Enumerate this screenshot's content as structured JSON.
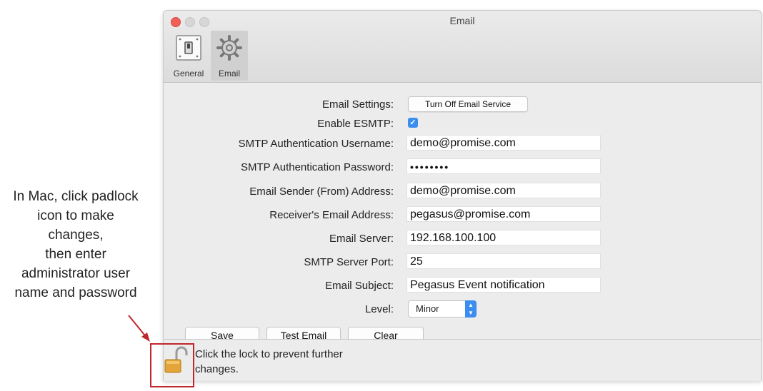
{
  "annotation": {
    "lines": [
      "In Mac, click padlock",
      "icon to make",
      "changes,",
      "then enter",
      "administrator user",
      "name and password"
    ],
    "color": "#c0272d"
  },
  "window": {
    "title": "Email",
    "toolbar": [
      {
        "label": "General",
        "icon": "general-switch-icon"
      },
      {
        "label": "Email",
        "icon": "gear-icon"
      }
    ]
  },
  "form": {
    "email_settings": {
      "label": "Email Settings:",
      "button": "Turn Off Email Service"
    },
    "enable_esmtp": {
      "label": "Enable ESMTP:",
      "checked": true
    },
    "smtp_username": {
      "label": "SMTP Authentication Username:",
      "value": "demo@promise.com"
    },
    "smtp_password": {
      "label": "SMTP Authentication Password:",
      "value": "••••••••"
    },
    "sender_address": {
      "label": "Email Sender (From) Address:",
      "value": "demo@promise.com"
    },
    "receiver_address": {
      "label": "Receiver's Email Address:",
      "value": "pegasus@promise.com"
    },
    "email_server": {
      "label": "Email Server:",
      "value": "192.168.100.100"
    },
    "smtp_port": {
      "label": "SMTP Server Port:",
      "value": "25"
    },
    "email_subject": {
      "label": "Email Subject:",
      "value": "Pegasus Event notification"
    },
    "level": {
      "label": "Level:",
      "value": "Minor"
    }
  },
  "actions": {
    "save": "Save",
    "test_email": "Test Email",
    "clear": "Clear"
  },
  "footer": {
    "lock_line1": "Click the lock to prevent further",
    "lock_line2": "changes.",
    "lock_icon": "padlock-open-icon"
  },
  "colors": {
    "accent": "#3b8df0",
    "close": "#f2605a",
    "highlight_box": "#c0272d"
  }
}
